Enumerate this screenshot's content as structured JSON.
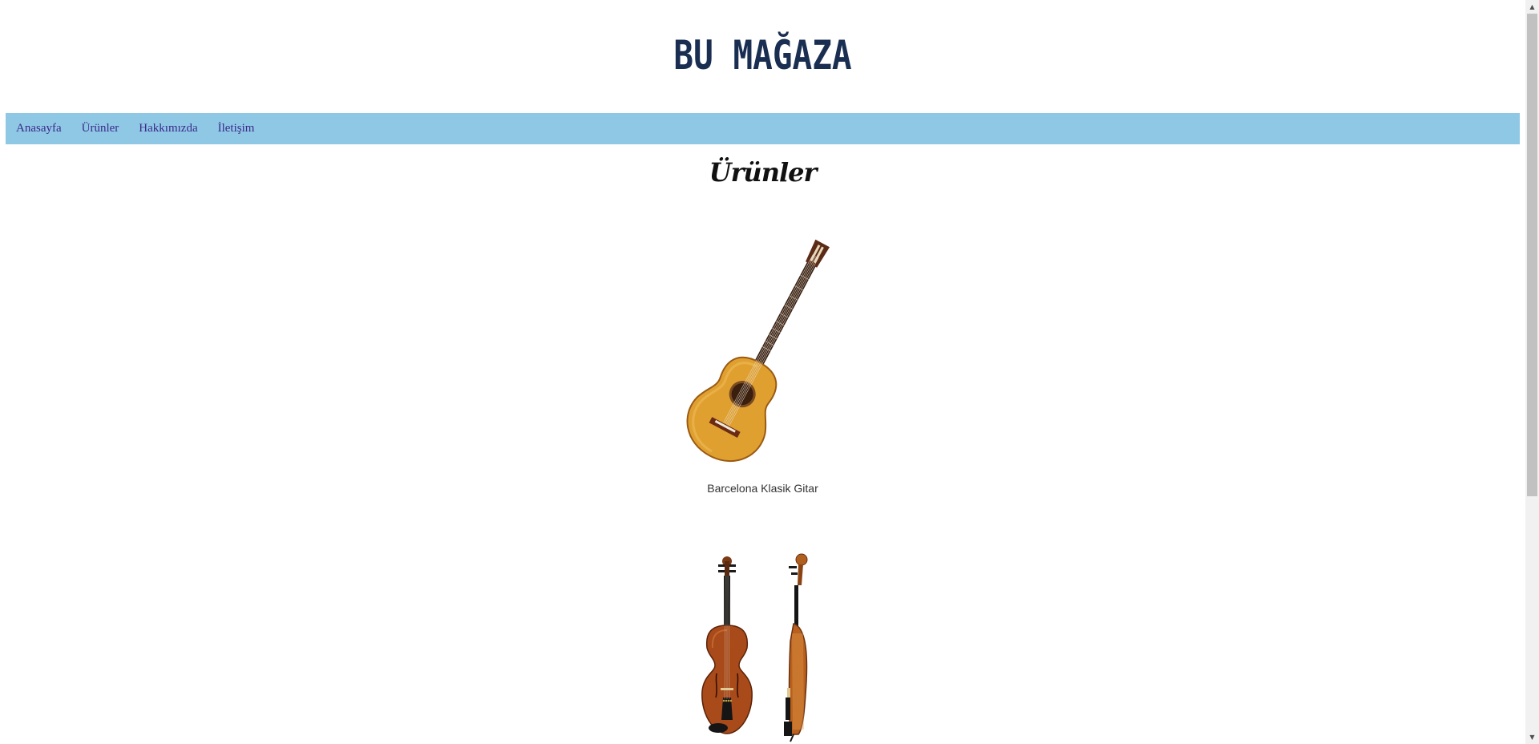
{
  "header": {
    "site_title": "BU MAĞAZA"
  },
  "nav": {
    "items": [
      {
        "label": "Anasayfa"
      },
      {
        "label": "Ürünler"
      },
      {
        "label": "Hakkımızda"
      },
      {
        "label": "İletişim"
      }
    ]
  },
  "main": {
    "section_title": "Ürünler",
    "products": [
      {
        "name": "Barcelona Klasik Gitar",
        "image": "classical-guitar"
      },
      {
        "name": "",
        "image": "violin-front-and-side"
      }
    ]
  },
  "colors": {
    "nav_background": "#8fc8e4",
    "nav_link": "#3b2a8c",
    "title": "#1a2e52"
  }
}
